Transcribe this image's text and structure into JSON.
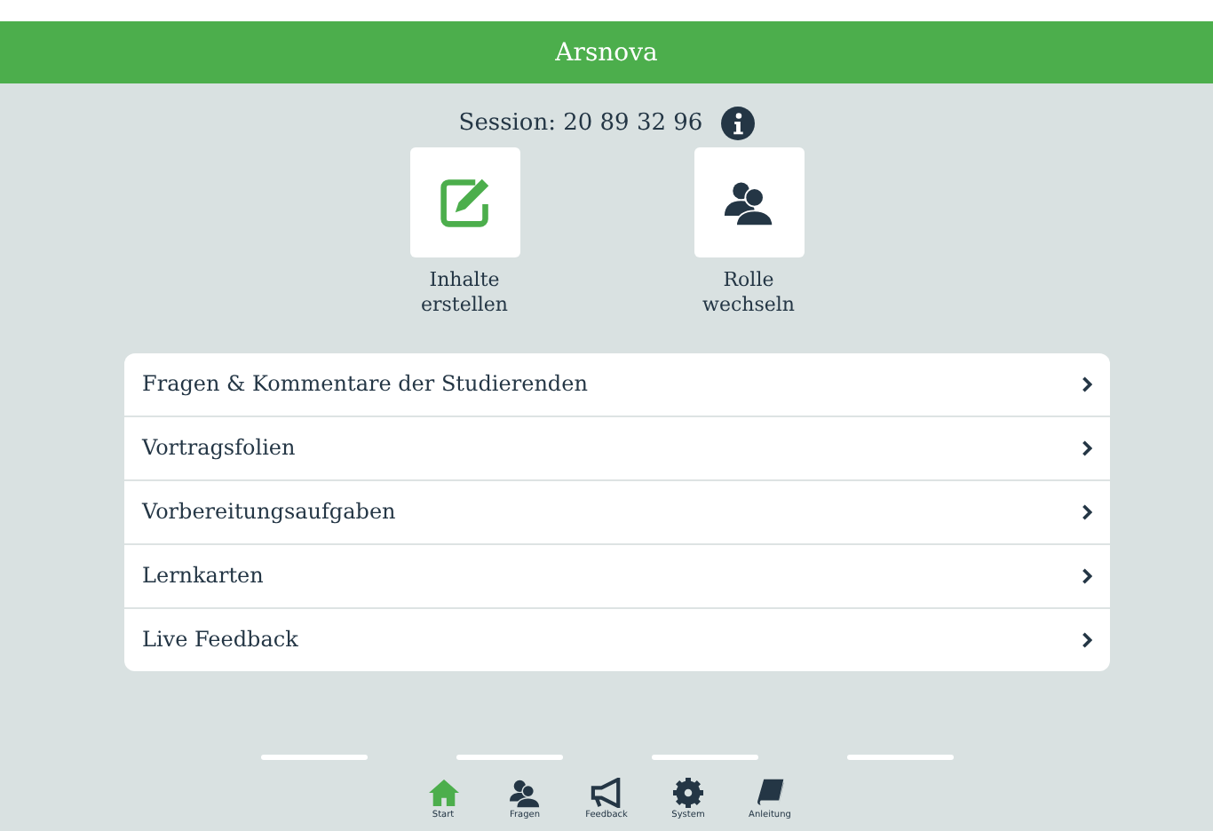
{
  "header": {
    "title": "Arsnova"
  },
  "session": {
    "label": "Session: 20 89 32 96"
  },
  "actions": [
    {
      "kind": "edit",
      "label": "Inhalte erstellen"
    },
    {
      "kind": "users",
      "label": "Rolle wechseln"
    }
  ],
  "menu": [
    {
      "label": "Fragen & Kommentare der Studierenden"
    },
    {
      "label": "Vortragsfolien"
    },
    {
      "label": "Vorbereitungsaufgaben"
    },
    {
      "label": "Lernkarten"
    },
    {
      "label": "Live Feedback"
    }
  ],
  "tabbar": [
    {
      "kind": "home",
      "label": "Start",
      "selected": true
    },
    {
      "kind": "users",
      "label": "Fragen",
      "selected": false
    },
    {
      "kind": "megaphone",
      "label": "Feedback",
      "selected": false
    },
    {
      "kind": "gear",
      "label": "System",
      "selected": false
    },
    {
      "kind": "book",
      "label": "Anleitung",
      "selected": false
    }
  ]
}
